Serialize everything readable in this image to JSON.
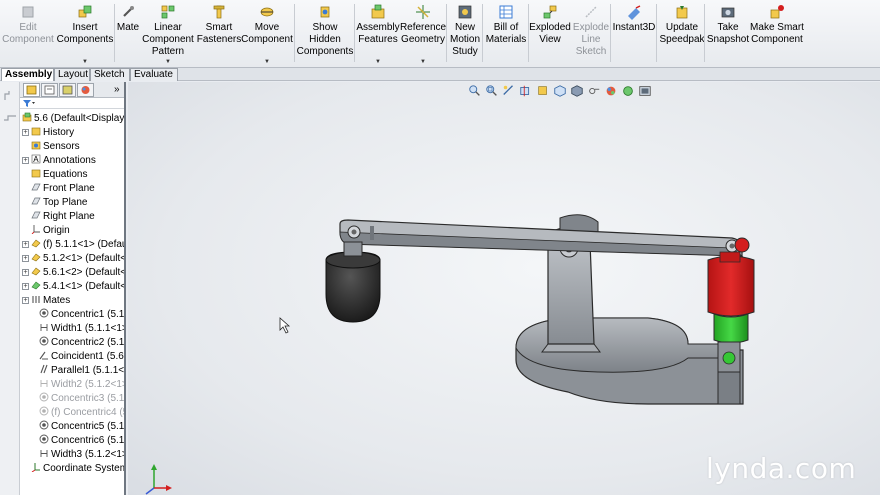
{
  "ribbon": {
    "commands": [
      {
        "id": "edit-component",
        "label": "Edit\nComponent",
        "icon": "edit-component-icon",
        "disabled": true,
        "dropdown": false
      },
      {
        "id": "insert-components",
        "label": "Insert\nComponents",
        "icon": "insert-components-icon",
        "disabled": false,
        "dropdown": true
      },
      {
        "id": "mate",
        "label": "Mate",
        "icon": "mate-icon",
        "disabled": false,
        "dropdown": false
      },
      {
        "id": "linear-component-pattern",
        "label": "Linear\nComponent\nPattern",
        "icon": "linear-pattern-icon",
        "disabled": false,
        "dropdown": true
      },
      {
        "id": "smart-fasteners",
        "label": "Smart\nFasteners",
        "icon": "smart-fasteners-icon",
        "disabled": false,
        "dropdown": false
      },
      {
        "id": "move-component",
        "label": "Move\nComponent",
        "icon": "move-component-icon",
        "disabled": false,
        "dropdown": true
      },
      {
        "id": "show-hidden-components",
        "label": "Show\nHidden\nComponents",
        "icon": "show-hidden-icon",
        "disabled": false,
        "dropdown": false
      },
      {
        "id": "assembly-features",
        "label": "Assembly\nFeatures",
        "icon": "assembly-features-icon",
        "disabled": false,
        "dropdown": true
      },
      {
        "id": "reference-geometry",
        "label": "Reference\nGeometry",
        "icon": "reference-geometry-icon",
        "disabled": false,
        "dropdown": true
      },
      {
        "id": "new-motion-study",
        "label": "New\nMotion\nStudy",
        "icon": "motion-study-icon",
        "disabled": false,
        "dropdown": false
      },
      {
        "id": "bill-of-materials",
        "label": "Bill of\nMaterials",
        "icon": "bill-of-materials-icon",
        "disabled": false,
        "dropdown": false
      },
      {
        "id": "exploded-view",
        "label": "Exploded\nView",
        "icon": "exploded-view-icon",
        "disabled": false,
        "dropdown": false
      },
      {
        "id": "explode-line-sketch",
        "label": "Explode\nLine\nSketch",
        "icon": "explode-line-icon",
        "disabled": true,
        "dropdown": false
      },
      {
        "id": "instant3d",
        "label": "Instant3D",
        "icon": "instant3d-icon",
        "disabled": false,
        "dropdown": false
      },
      {
        "id": "update-speedpak",
        "label": "Update\nSpeedpak",
        "icon": "speedpak-icon",
        "disabled": false,
        "dropdown": false
      },
      {
        "id": "take-snapshot",
        "label": "Take\nSnapshot",
        "icon": "snapshot-icon",
        "disabled": false,
        "dropdown": false
      },
      {
        "id": "make-smart-component",
        "label": "Make Smart\nComponent",
        "icon": "smart-component-icon",
        "disabled": false,
        "dropdown": false
      }
    ]
  },
  "tabs": [
    {
      "label": "Assembly",
      "active": true
    },
    {
      "label": "Layout",
      "active": false
    },
    {
      "label": "Sketch",
      "active": false
    },
    {
      "label": "Evaluate",
      "active": false
    }
  ],
  "tree": {
    "items": [
      {
        "label": "5.6  (Default<Display",
        "icon": "assembly-icon",
        "level": 0,
        "expand": false,
        "suppressed": false
      },
      {
        "label": "History",
        "icon": "history-icon",
        "level": 1,
        "expand": true,
        "suppressed": false
      },
      {
        "label": "Sensors",
        "icon": "sensors-icon",
        "level": 1,
        "expand": false,
        "suppressed": false
      },
      {
        "label": "Annotations",
        "icon": "annotations-icon",
        "level": 1,
        "expand": true,
        "suppressed": false
      },
      {
        "label": "Equations",
        "icon": "equations-icon",
        "level": 1,
        "expand": false,
        "suppressed": false
      },
      {
        "label": "Front Plane",
        "icon": "plane-icon",
        "level": 1,
        "expand": false,
        "suppressed": false
      },
      {
        "label": "Top Plane",
        "icon": "plane-icon",
        "level": 1,
        "expand": false,
        "suppressed": false
      },
      {
        "label": "Right Plane",
        "icon": "plane-icon",
        "level": 1,
        "expand": false,
        "suppressed": false
      },
      {
        "label": "Origin",
        "icon": "origin-icon",
        "level": 1,
        "expand": false,
        "suppressed": false
      },
      {
        "label": "(f) 5.1.1<1> (Defaul",
        "icon": "part-icon",
        "level": 1,
        "expand": true,
        "suppressed": false
      },
      {
        "label": "5.1.2<1> (Default<",
        "icon": "part-icon",
        "level": 1,
        "expand": true,
        "suppressed": false
      },
      {
        "label": "5.6.1<2> (Default<",
        "icon": "part-icon",
        "level": 1,
        "expand": true,
        "suppressed": false
      },
      {
        "label": "5.4.1<1> (Default<",
        "icon": "part-green-icon",
        "level": 1,
        "expand": true,
        "suppressed": false
      },
      {
        "label": "Mates",
        "icon": "mates-icon",
        "level": 1,
        "expand": true,
        "suppressed": false
      },
      {
        "label": "Concentric1 (5.1.",
        "icon": "concentric-icon",
        "level": 2,
        "expand": false,
        "suppressed": false
      },
      {
        "label": "Width1 (5.1.1<1>",
        "icon": "width-icon",
        "level": 2,
        "expand": false,
        "suppressed": false
      },
      {
        "label": "Concentric2 (5.1.",
        "icon": "concentric-icon",
        "level": 2,
        "expand": false,
        "suppressed": false
      },
      {
        "label": "Coincident1 (5.6.",
        "icon": "coincident-icon",
        "level": 2,
        "expand": false,
        "suppressed": false
      },
      {
        "label": "Parallel1 (5.1.1<1",
        "icon": "parallel-icon",
        "level": 2,
        "expand": false,
        "suppressed": false
      },
      {
        "label": "Width2 (5.1.2<1>",
        "icon": "width-icon",
        "level": 2,
        "expand": false,
        "suppressed": true
      },
      {
        "label": "Concentric3 (5.1.",
        "icon": "concentric-icon",
        "level": 2,
        "expand": false,
        "suppressed": true
      },
      {
        "label": "(f) Concentric4 (5",
        "icon": "concentric-icon",
        "level": 2,
        "expand": false,
        "suppressed": true
      },
      {
        "label": "Concentric5 (5.1.",
        "icon": "concentric-icon",
        "level": 2,
        "expand": false,
        "suppressed": false
      },
      {
        "label": "Concentric6 (5.1.",
        "icon": "concentric-icon",
        "level": 2,
        "expand": false,
        "suppressed": false
      },
      {
        "label": "Width3 (5.1.2<1>",
        "icon": "width-icon",
        "level": 2,
        "expand": false,
        "suppressed": false
      },
      {
        "label": "Coordinate System",
        "icon": "coordinate-system-icon",
        "level": 1,
        "expand": false,
        "suppressed": false
      }
    ]
  },
  "hud": {
    "icons": [
      "zoom-to-fit-icon",
      "zoom-area-icon",
      "previous-view-icon",
      "section-view-icon",
      "dynamic-annotation-icon",
      "view-orientation-icon",
      "display-style-icon",
      "hide-show-icon",
      "edit-appearance-icon",
      "apply-scene-icon",
      "view-settings-icon"
    ]
  },
  "watermark": "lynda.com",
  "colors": {
    "accent": "#3a7bd5",
    "part_gray": "#9a9fa5",
    "part_red": "#d41e1e",
    "part_green": "#2fc02f",
    "part_black": "#2a2a2a"
  }
}
